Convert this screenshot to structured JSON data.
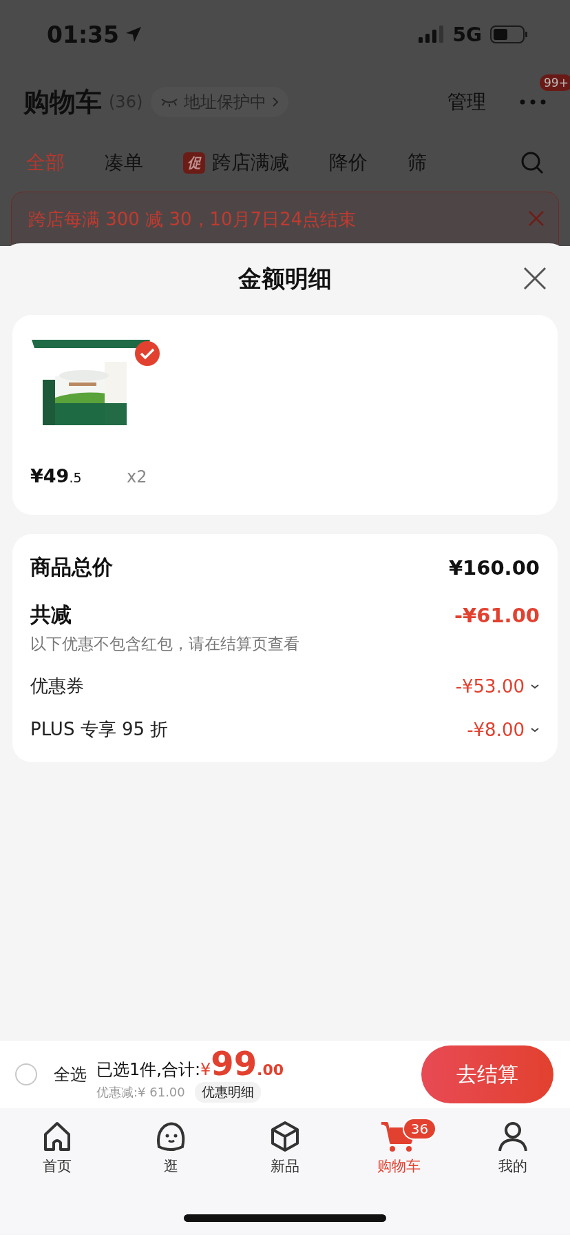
{
  "status_bar": {
    "time": "01:35",
    "network": "5G"
  },
  "header": {
    "title": "购物车",
    "count": "(36)",
    "address_pill": "地址保护中",
    "manage": "管理",
    "more_badge": "99+"
  },
  "filter_tabs": [
    {
      "label": "全部",
      "selected": true
    },
    {
      "label": "凑单",
      "selected": false
    },
    {
      "label": "跨店满减",
      "badge": "促",
      "selected": false
    },
    {
      "label": "降价",
      "selected": false
    },
    {
      "label": "筛",
      "selected": false
    }
  ],
  "promo_banner": {
    "text": "跨店每满 300 减 30，10月7日24点结束"
  },
  "sheet": {
    "title": "金额明细",
    "products": [
      {
        "kind": "picture",
        "checked": true,
        "price_int": "¥49",
        "price_dec": ".5",
        "quantity": "x2"
      }
    ],
    "summary": {
      "total_label": "商品总价",
      "total_value": "¥160.00",
      "discount_label": "共减",
      "discount_value": "-¥61.00",
      "note": "以下优惠不包含红包，请在结算页查看",
      "items": [
        {
          "label": "优惠券",
          "value": "-¥53.00"
        },
        {
          "label": "PLUS 专享 95 折",
          "value": "-¥8.00"
        }
      ]
    }
  },
  "checkout_bar": {
    "select_all": {
      "label": "全选",
      "checked": false
    },
    "selected_text": "已选1件,合计:",
    "currency": "¥",
    "total_int": "99",
    "total_dec": ".00",
    "saving": "优惠减:¥ 61.00",
    "detail_button": "优惠明细",
    "checkout_button": "去结算"
  },
  "tab_bar": [
    {
      "label": "首页",
      "kind": "home",
      "selected": false
    },
    {
      "label": "逛",
      "kind": "face",
      "selected": false
    },
    {
      "label": "新品",
      "kind": "cube",
      "selected": false
    },
    {
      "label": "购物车",
      "kind": "cart",
      "badge": "36",
      "selected": true
    },
    {
      "label": "我的",
      "kind": "person",
      "selected": false
    }
  ]
}
